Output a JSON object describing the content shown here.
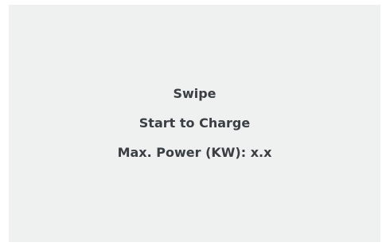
{
  "display": {
    "line1": "Swipe",
    "line2": "Start to Charge",
    "line3": "Max. Power (KW): x.x"
  },
  "colors": {
    "screen_background": "#eff1f0",
    "text": "#3a3f44"
  }
}
